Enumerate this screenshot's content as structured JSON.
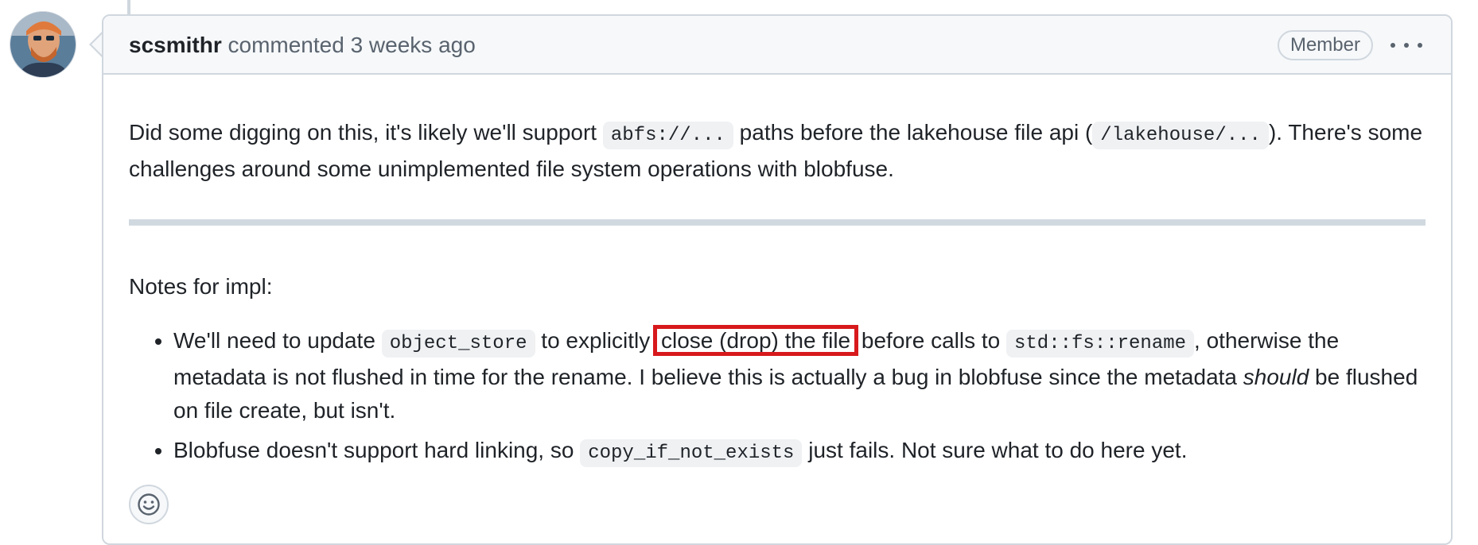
{
  "comment": {
    "author": "scsmithr",
    "action": "commented",
    "time": "3 weeks ago",
    "role_badge": "Member",
    "paragraph1": {
      "t1": "Did some digging on this, it's likely we'll support ",
      "code1": "abfs://...",
      "t2": " paths before the lakehouse file api (",
      "code2": "/lakehouse/...",
      "t3": "). There's some challenges around some unimplemented file system operations with blobfuse."
    },
    "notes_heading": "Notes for impl:",
    "bullets": [
      {
        "t1": "We'll need to update ",
        "code1": "object_store",
        "t2": " to explicitly ",
        "highlight": "close (drop) the file",
        "t3": " before calls to ",
        "code2": "std::fs::rename",
        "t4": ", otherwise the metadata is not flushed in time for the rename. I believe this is actually a bug in blobfuse since the metadata ",
        "em": "should",
        "t5": " be flushed on file create, but isn't."
      },
      {
        "t1": "Blobfuse doesn't support hard linking, so ",
        "code1": "copy_if_not_exists",
        "t2": " just fails. Not sure what to do here yet."
      }
    ]
  },
  "icons": {
    "avatar": "user-avatar",
    "more": "kebab-horizontal-icon",
    "reaction": "smiley-icon"
  },
  "colors": {
    "highlight_box": "#d7191c",
    "header_bg": "#f6f8fa",
    "border": "#d0d7de"
  }
}
